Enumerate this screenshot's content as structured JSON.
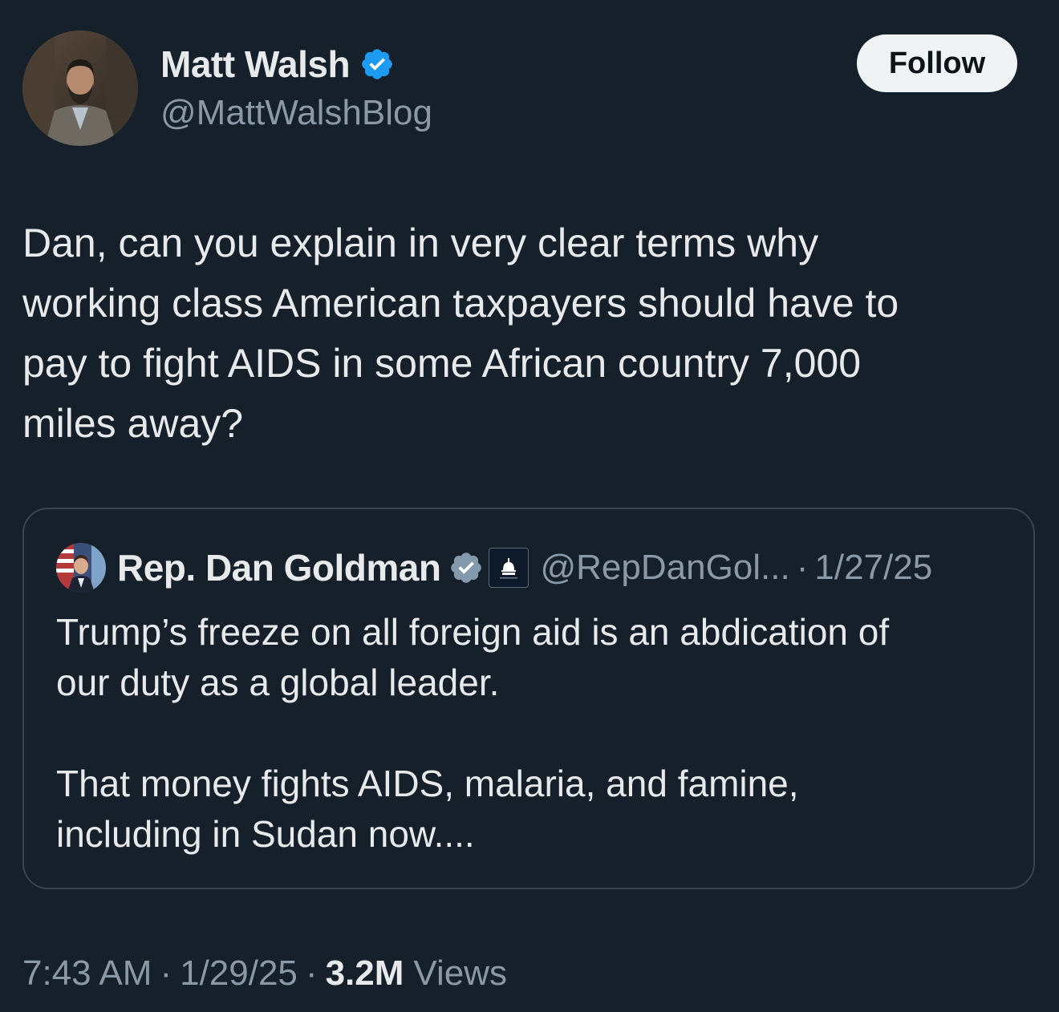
{
  "author": {
    "name": "Matt Walsh",
    "handle": "@MattWalshBlog",
    "verified": true,
    "avatar_icon": "profile-photo"
  },
  "follow_button": {
    "label": "Follow"
  },
  "tweet": {
    "text": "Dan, can you explain in very clear terms why\nworking class American taxpayers should have to\npay to fight AIDS in some African country 7,000\nmiles away?"
  },
  "quoted_tweet": {
    "name": "Rep. Dan Goldman",
    "handle": "@RepDanGol...",
    "separator": "·",
    "date": "1/27/25",
    "verified_badge": "gray-government-check",
    "affiliate_badge_icon": "capitol-dome-icon",
    "text": "Trump’s freeze on all foreign aid is an abdication of\nour duty as a global leader.\n\nThat money fights AIDS, malaria, and famine,\nincluding in Sudan now...."
  },
  "meta": {
    "time": "7:43 AM",
    "separator": "·",
    "date": "1/29/25",
    "views_count": "3.2M",
    "views_label": "Views"
  },
  "colors": {
    "background": "#15202b",
    "text_primary": "#e7e9ea",
    "text_secondary": "#8b98a5",
    "verified_blue": "#1d9bf0",
    "government_gray": "#829aab",
    "border": "#38444d",
    "button_bg": "#eff3f4"
  }
}
